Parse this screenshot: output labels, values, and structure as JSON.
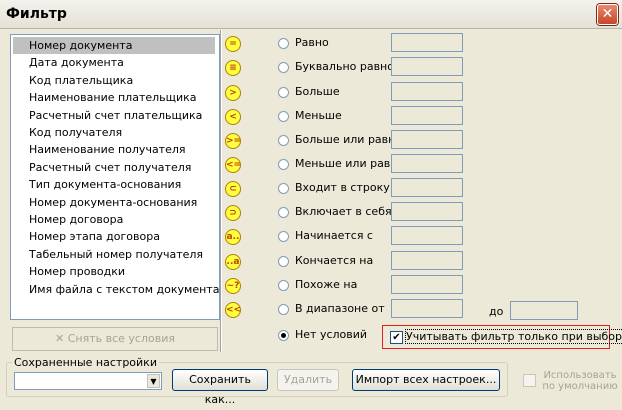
{
  "window": {
    "title": "Фильтр",
    "close_glyph": "✕"
  },
  "fields": [
    "Номер документа",
    "Дата документа",
    "Код плательщика",
    "Наименование плательщика",
    "Расчетный счет плательщика",
    "Код получателя",
    "Наименование получателя",
    "Расчетный счет получателя",
    "Тип документа-основания",
    "Номер документа-основания",
    "Номер договора",
    "Номер этапа договора",
    "Табельный номер получателя",
    "Номер проводки",
    "Имя файла с текстом документа"
  ],
  "selected_field": "Номер документа",
  "clear_button": {
    "icon": "✕",
    "label": "Снять все условия"
  },
  "operators": [
    {
      "icon": "=",
      "label": "Равно"
    },
    {
      "icon": "≡",
      "label": "Буквально равно"
    },
    {
      "icon": ">",
      "label": "Больше"
    },
    {
      "icon": "<",
      "label": "Меньше"
    },
    {
      "icon": ">=",
      "label": "Больше или равно"
    },
    {
      "icon": "<=",
      "label": "Меньше или равно"
    },
    {
      "icon": "⊂",
      "label": "Входит в строку"
    },
    {
      "icon": "⊃",
      "label": "Включает в себя"
    },
    {
      "icon": "a..",
      "label": "Начинается с"
    },
    {
      "icon": "..a",
      "label": "Кончается на"
    },
    {
      "icon": "~?",
      "label": "Похоже на"
    },
    {
      "icon": "<<",
      "label": "В диапазоне от"
    },
    {
      "icon": "",
      "label": "Нет условий"
    }
  ],
  "selected_operator": "Нет условий",
  "range_to_label": "до",
  "apply_on_select": {
    "label": "Учитывать фильтр только при выборке",
    "checked": true,
    "mark": "✔"
  },
  "saved_settings": {
    "group_label": "Сохраненные настройки",
    "combo_value": "",
    "combo_arrow": "▼",
    "save_as": "Сохранить как...",
    "delete": "Удалить",
    "import_all": "Импорт всех настроек...",
    "use_default": "Использовать по умолчанию",
    "use_default_checked": false
  },
  "colors": {
    "operator_icon_fill": "#ffff40",
    "highlight_border": "#e02020",
    "selection": "#c0c0c0"
  }
}
